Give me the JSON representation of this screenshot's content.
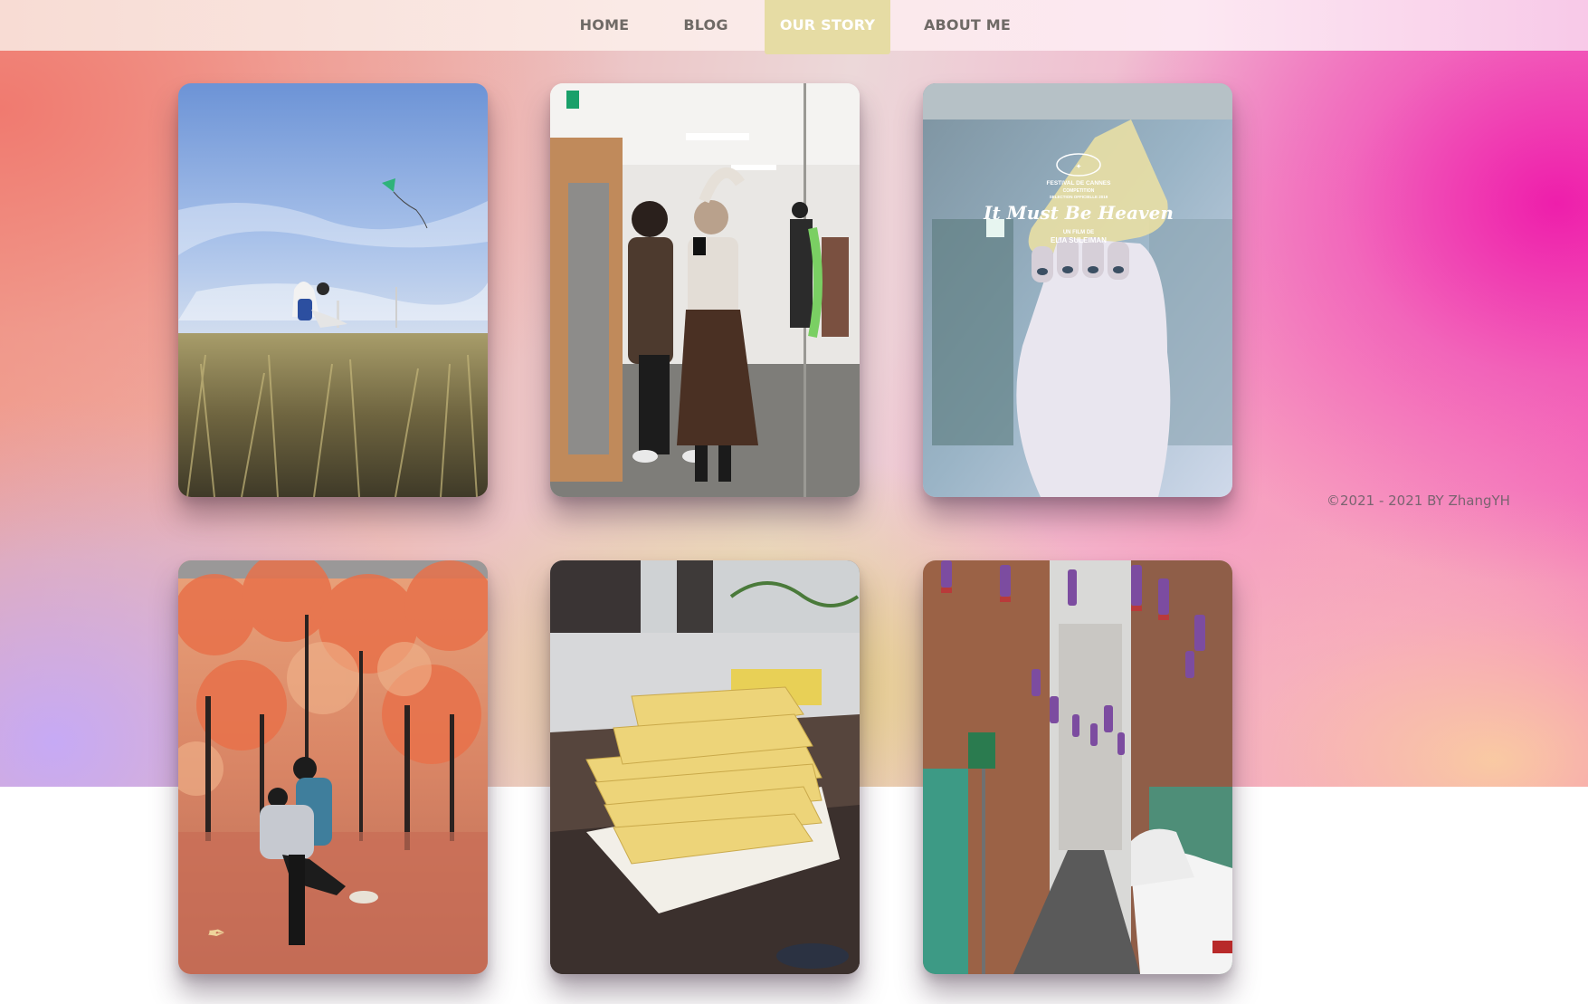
{
  "nav": {
    "items": [
      {
        "label": "HOME",
        "active": false
      },
      {
        "label": "BLOG",
        "active": false
      },
      {
        "label": "OUR STORY",
        "active": true
      },
      {
        "label": "ABOUT ME",
        "active": false
      }
    ],
    "active_color": "#e6dca4",
    "text_color": "#6f6a66"
  },
  "gallery": {
    "photos": [
      {
        "subject": "person sitting on grass flying a kite under blue sky"
      },
      {
        "subject": "couple taking mirror selfie in office hallway"
      },
      {
        "subject": "hand holding subway grab handle with film poster overlay",
        "poster": {
          "festival": "FESTIVAL DE CANNES",
          "competition": "COMPETITION",
          "selection": "SELECTION OFFICIELLE 2019",
          "title": "It Must Be Heaven",
          "credit_line1": "UN FILM DE",
          "credit_line2": "ELIA SULEIMAN"
        }
      },
      {
        "subject": "couple embracing in autumn maple forest"
      },
      {
        "subject": "stack of fried cakes on napkin on desk"
      },
      {
        "subject": "narrow street with hanging lanterns and parked cars"
      }
    ]
  },
  "footer": {
    "copyright": "©2021 - 2021 BY ZhangYH"
  },
  "colors": {
    "accent_magenta": "#ee19aa",
    "accent_coral": "#f1a18e",
    "accent_lavender": "#c4aafa",
    "accent_gold": "#e1cd6e"
  }
}
